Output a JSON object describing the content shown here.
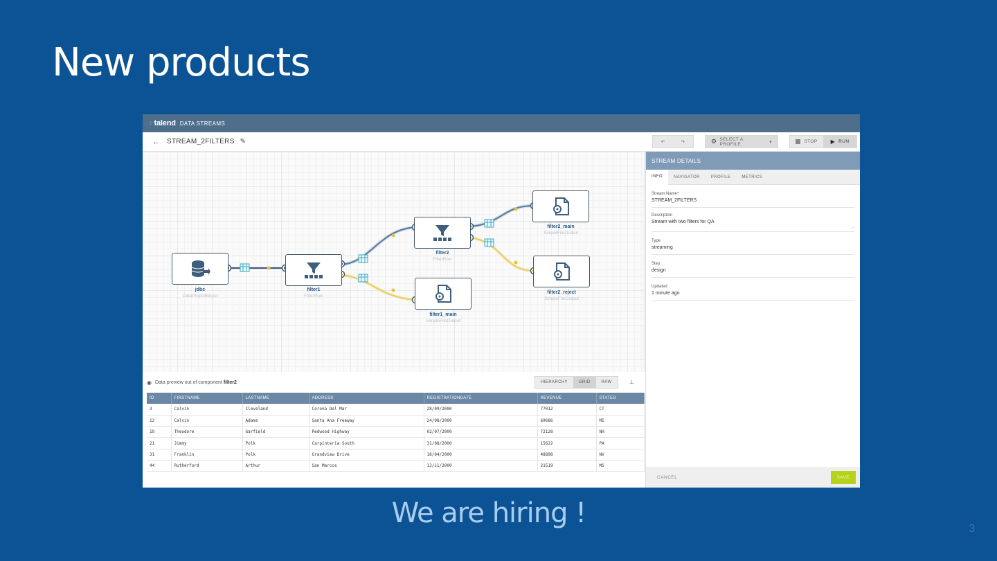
{
  "slide": {
    "title": "New products",
    "subtitle": "We are hiring !",
    "page_number": "3"
  },
  "app": {
    "logo": "talend",
    "product": "DATA STREAMS",
    "stream_name": "STREAM_2FILTERS",
    "toolbar": {
      "undo_icon": "undo-arrow-icon",
      "redo_icon": "redo-arrow-icon",
      "profile_label": "SELECT A PROFILE",
      "stop_label": "STOP",
      "run_label": "RUN"
    },
    "nodes": [
      {
        "name": "jdbc",
        "type": "DataPrepDBInput",
        "icon": "database-icon"
      },
      {
        "name": "filter1",
        "type": "FilterRow",
        "icon": "funnel-icon"
      },
      {
        "name": "filter2",
        "type": "FilterRow",
        "icon": "funnel-icon"
      },
      {
        "name": "filter1_main",
        "type": "SimpleFileOutput",
        "icon": "file-gear-icon"
      },
      {
        "name": "filter2_main",
        "type": "SimpleFileOutput",
        "icon": "file-gear-icon"
      },
      {
        "name": "filter2_reject",
        "type": "SimpleFileOutput",
        "icon": "file-gear-icon"
      }
    ],
    "details": {
      "header": "STREAM DETAILS",
      "tabs": [
        "INFO",
        "NAVIGATOR",
        "PROFILE",
        "METRICS"
      ],
      "active_tab": "INFO",
      "fields": [
        {
          "label": "Stream Name*",
          "value": "STREAM_2FILTERS"
        },
        {
          "label": "Description",
          "value": "Stream with two filters for QA"
        },
        {
          "label": "Type",
          "value": "streaming"
        },
        {
          "label": "Step",
          "value": "design"
        },
        {
          "label": "Updated",
          "value": "1 minute ago"
        }
      ],
      "cancel_label": "CANCEL",
      "save_label": "SAVE"
    },
    "preview": {
      "text_prefix": "Data preview out of component",
      "component": "filter2",
      "views": [
        "HIERARCHY",
        "GRID",
        "RAW"
      ],
      "active_view": "GRID",
      "columns": [
        "ID",
        "FIRSTNAME",
        "LASTNAME",
        "ADDRESS",
        "REGISTRATIONDATE",
        "REVENUE",
        "STATES"
      ],
      "rows": [
        [
          "3",
          "Calvin",
          "Cleveland",
          "Corona Del Mar",
          "28/09/2000",
          "77012",
          "CT"
        ],
        [
          "12",
          "Calvin",
          "Adams",
          "Santa Ana Freeway",
          "24/08/2000",
          "69686",
          "MI"
        ],
        [
          "19",
          "Theodore",
          "Garfield",
          "Redwood Highway",
          "02/07/2000",
          "72128",
          "NH"
        ],
        [
          "21",
          "Jimmy",
          "Polk",
          "Carpinteria South",
          "31/08/2000",
          "15622",
          "PA"
        ],
        [
          "31",
          "Franklin",
          "Polk",
          "Grandview Drive",
          "18/04/2000",
          "48898",
          "NV"
        ],
        [
          "44",
          "Rutherford",
          "Arthur",
          "San Marcos",
          "13/11/2000",
          "21519",
          "MS"
        ]
      ]
    }
  }
}
